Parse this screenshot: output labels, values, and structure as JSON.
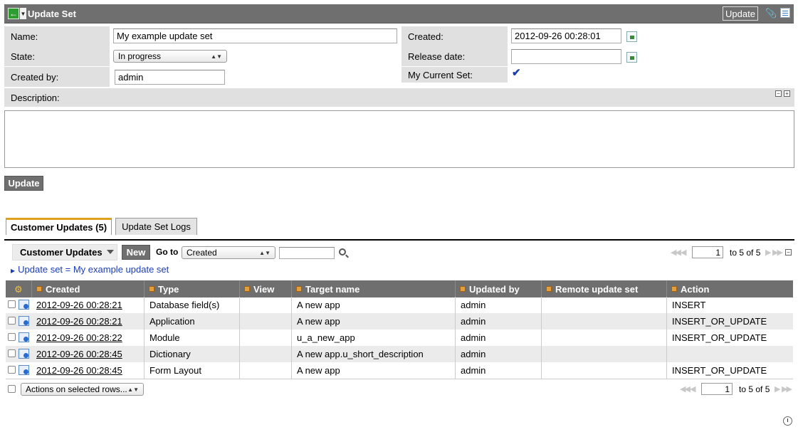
{
  "header": {
    "title": "Update Set",
    "update_label": "Update"
  },
  "form": {
    "name_label": "Name:",
    "name_value": "My example update set",
    "state_label": "State:",
    "state_value": "In progress",
    "created_by_label": "Created by:",
    "created_by_value": "admin",
    "created_label": "Created:",
    "created_value": "2012-09-26 00:28:01",
    "release_date_label": "Release date:",
    "release_date_value": "",
    "current_set_label": "My Current Set:",
    "current_set_checked": true,
    "description_label": "Description:",
    "description_value": "",
    "update_button": "Update"
  },
  "tabs": [
    {
      "label": "Customer Updates (5)",
      "active": true
    },
    {
      "label": "Update Set Logs",
      "active": false
    }
  ],
  "list": {
    "title": "Customer Updates",
    "new_label": "New",
    "goto_label": "Go to",
    "goto_field": "Created",
    "search_value": "",
    "page_value": "1",
    "page_text": "to 5 of 5",
    "filter_text": "Update set = My example update set",
    "columns": [
      "Created",
      "Type",
      "View",
      "Target name",
      "Updated by",
      "Remote update set",
      "Action"
    ],
    "rows": [
      {
        "created": "2012-09-26 00:28:21",
        "type": "Database field(s)",
        "view": "",
        "target": "A new app",
        "updated_by": "admin",
        "remote": "",
        "action": "INSERT"
      },
      {
        "created": "2012-09-26 00:28:21",
        "type": "Application",
        "view": "",
        "target": "A new app",
        "updated_by": "admin",
        "remote": "",
        "action": "INSERT_OR_UPDATE"
      },
      {
        "created": "2012-09-26 00:28:22",
        "type": "Module",
        "view": "",
        "target": "u_a_new_app",
        "updated_by": "admin",
        "remote": "",
        "action": "INSERT_OR_UPDATE"
      },
      {
        "created": "2012-09-26 00:28:45",
        "type": "Dictionary",
        "view": "",
        "target": "A new app.u_short_description",
        "updated_by": "admin",
        "remote": "",
        "action": ""
      },
      {
        "created": "2012-09-26 00:28:45",
        "type": "Form Layout",
        "view": "",
        "target": "A new app",
        "updated_by": "admin",
        "remote": "",
        "action": "INSERT_OR_UPDATE"
      }
    ],
    "actions_select": "Actions on selected rows...",
    "bottom_page_value": "1",
    "bottom_page_text": "to 5 of 5"
  },
  "icons": {
    "back": "back-arrow-icon",
    "attachment": "paperclip-icon",
    "list": "list-icon",
    "calendar": "calendar-icon",
    "gear": "gear-icon",
    "search": "search-icon",
    "record": "record-icon",
    "timer": "clock-icon"
  },
  "colors": {
    "header_bg": "#6f6f6f",
    "tab_accent": "#e0a020",
    "filter_link": "#1a3db8"
  }
}
